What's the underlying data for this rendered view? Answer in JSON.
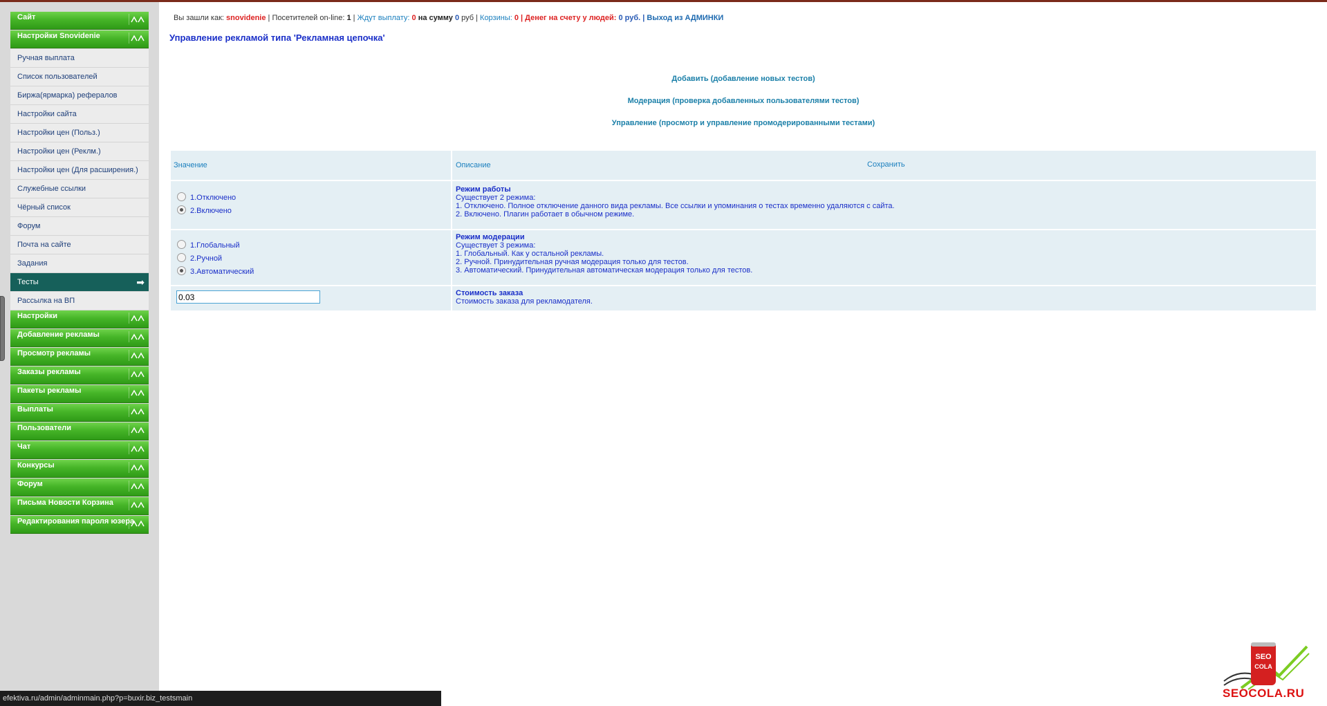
{
  "header": {
    "login_prefix": "Вы зашли как:",
    "username": "snovidenie",
    "visitors_label": "| Посетителей on-line:",
    "visitors_count": "1",
    "sep1": "|",
    "waiting_label": "Ждут выплату:",
    "waiting_count": "0",
    "sum_label": "на сумму",
    "sum_value": "0",
    "sum_unit": "руб",
    "sep2": "|",
    "carts_label": "Корзины:",
    "carts_count": "0",
    "money_label": "| Денег на счету у людей:",
    "money_value": "0 руб.",
    "sep3": "|",
    "exit_label": "Выход из АДМИНКИ"
  },
  "page_title": "Управление рекламой типа 'Рекламная цепочка'",
  "links": [
    "Добавить (добавление новых тестов)",
    "Модерация (проверка добавленных пользователями тестов)",
    "Управление (просмотр и управление промодерированными тестами)"
  ],
  "table": {
    "col_value": "Значение",
    "col_desc": "Описание",
    "save_label": "Сохранить",
    "rows": [
      {
        "options": [
          "1.Отключено",
          "2.Включено"
        ],
        "selected": 1,
        "title": "Режим работы",
        "lines": [
          "Существует 2 режима:",
          "1. Отключено. Полное отключение данного вида рекламы. Все ссылки и упоминания о тестах временно удаляются с сайта.",
          "2. Включено. Плагин работает в обычном режиме."
        ]
      },
      {
        "options": [
          "1.Глобальный",
          "2.Ручной",
          "3.Автоматический"
        ],
        "selected": 2,
        "title": "Режим модерации",
        "lines": [
          "Существует 3 режима:",
          "1. Глобальный. Как у остальной рекламы.",
          "2. Ручной. Принудительная ручная модерация только для тестов.",
          "3. Автоматический. Принудительная автоматическая модерация только для тестов."
        ]
      },
      {
        "input_value": "0.03",
        "title": "Стоимость заказа",
        "lines": [
          "Стоимость заказа для рекламодателя."
        ]
      }
    ]
  },
  "sidebar": {
    "groups_top": [
      "Сайт",
      "Настройки Snovidenie"
    ],
    "items": [
      "Ручная выплата",
      "Список пользователей",
      "Биржа(ярмарка) рефералов",
      "Настройки сайта",
      "Настройки цен (Польз.)",
      "Настройки цен (Реклм.)",
      "Настройки цен (Для расширения.)",
      "Служебные ссылки",
      "Чёрный список",
      "Форум",
      "Почта на сайте",
      "Задания",
      "Тесты",
      "Рассылка на ВП"
    ],
    "active_item": "Тесты",
    "groups_bottom": [
      "Настройки",
      "Добавление рекламы",
      "Просмотр рекламы",
      "Заказы рекламы",
      "Пакеты рекламы",
      "Выплаты",
      "Пользователи",
      "Чат",
      "Конкурсы",
      "Форум",
      "Письма Новости Корзина",
      "Редактирования пароля юзера"
    ]
  },
  "statusbar_url": "efektiva.ru/admin/adminmain.php?p=buxir.biz_testsmain",
  "logo": {
    "can_text": "SEO COLA",
    "site_text": "SEOCOLA.RU"
  }
}
